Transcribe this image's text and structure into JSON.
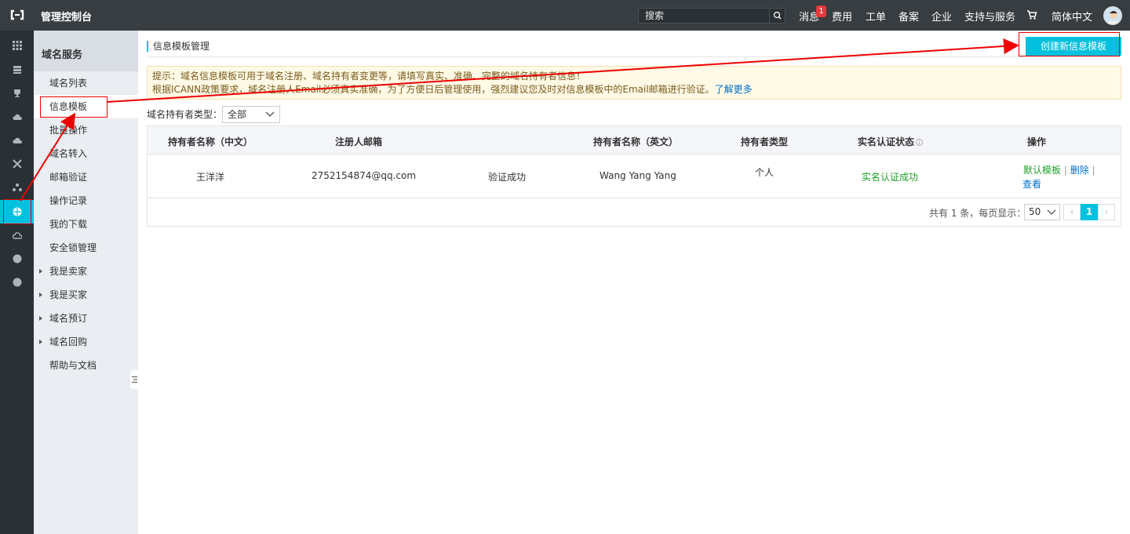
{
  "topbar": {
    "title": "管理控制台",
    "search_placeholder": "搜索",
    "messages_label": "消息",
    "messages_count": "1",
    "links": [
      "费用",
      "工单",
      "备案",
      "企业",
      "支持与服务"
    ],
    "language": "简体中文"
  },
  "sidebar": {
    "heading": "域名服务",
    "items": [
      {
        "label": "域名列表"
      },
      {
        "label": "信息模板"
      },
      {
        "label": "批量操作"
      },
      {
        "label": "域名转入"
      },
      {
        "label": "邮箱验证"
      },
      {
        "label": "操作记录"
      },
      {
        "label": "我的下载"
      },
      {
        "label": "安全锁管理"
      },
      {
        "label": "我是卖家"
      },
      {
        "label": "我是买家"
      },
      {
        "label": "域名预订"
      },
      {
        "label": "域名回购"
      },
      {
        "label": "帮助与文档"
      }
    ]
  },
  "main": {
    "page_title": "信息模板管理",
    "create_button": "创建新信息模板",
    "notice_line1": "提示：域名信息模板可用于域名注册、域名持有者变更等，请填写真实、准确、完整的域名持有者信息！",
    "notice_line2": "根据ICANN政策要求，域名注册人Email必须真实准确，为了方便日后管理使用，强烈建议您及时对信息模板中的Email邮箱进行验证。",
    "notice_link": "了解更多",
    "filter_label": "域名持有者类型：",
    "filter_value": "全部",
    "table": {
      "headers": [
        "持有者名称（中文）",
        "注册人邮箱",
        "持有者名称（英文）",
        "持有者类型",
        "实名认证状态",
        "操作"
      ],
      "row": {
        "name_cn": "王洋洋",
        "email": "2752154874@qq.com",
        "email_status": "验证成功",
        "name_en": "Wang Yang Yang",
        "type": "个人",
        "realname_status": "实名认证成功",
        "action_default": "默认模板",
        "action_delete": "删除",
        "action_view": "查看"
      }
    },
    "pager": {
      "summary": "共有 1 条，每页显示：",
      "page_size": "50",
      "prev": "‹",
      "current": "1",
      "next": "›"
    }
  },
  "colors": {
    "topbar": "#373d41",
    "rail": "#293036",
    "accent": "#00c1de",
    "annotation": "#e00000",
    "success": "#1fa12a",
    "link": "#0070cc"
  }
}
